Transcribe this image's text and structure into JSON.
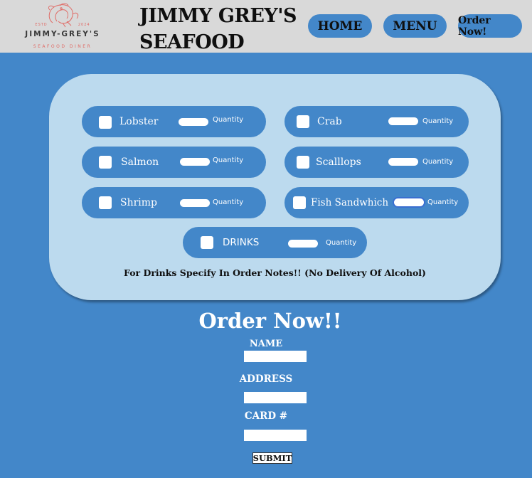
{
  "header": {
    "logo": {
      "name": "JIMMY-GREY'S",
      "subtitle": "SEAFOOD DINER",
      "est": "ESTD",
      "year": "2024"
    },
    "brand_line1": "JIMMY GREY'S",
    "brand_line2": "SEAFOOD",
    "nav": {
      "home": "HOME",
      "menu": "MENU",
      "order": "Order Now!"
    }
  },
  "menu": {
    "quantity_label": "Quantity",
    "items": [
      {
        "name": "Lobster",
        "checked": false,
        "quantity": ""
      },
      {
        "name": "Crab",
        "checked": false,
        "quantity": ""
      },
      {
        "name": "Salmon",
        "checked": false,
        "quantity": ""
      },
      {
        "name": "Scalllops",
        "checked": false,
        "quantity": ""
      },
      {
        "name": "Shrimp",
        "checked": false,
        "quantity": ""
      },
      {
        "name": "Fish Sandwhich",
        "checked": false,
        "quantity": ""
      },
      {
        "name": "DRINKS",
        "checked": false,
        "quantity": ""
      }
    ],
    "note": "For Drinks Specify In Order Notes!! (No Delivery Of Alcohol)"
  },
  "order_form": {
    "title": "Order Now!!",
    "name_label": "NAME",
    "address_label": "ADDRESS",
    "card_label": "CARD #",
    "name_value": "",
    "address_value": "",
    "card_value": "",
    "submit_label": "SUBMIT"
  },
  "colors": {
    "background": "#4387c9",
    "header": "#d9d9d9",
    "panel": "#bcdaee",
    "logo_accent": "#e06b66"
  }
}
